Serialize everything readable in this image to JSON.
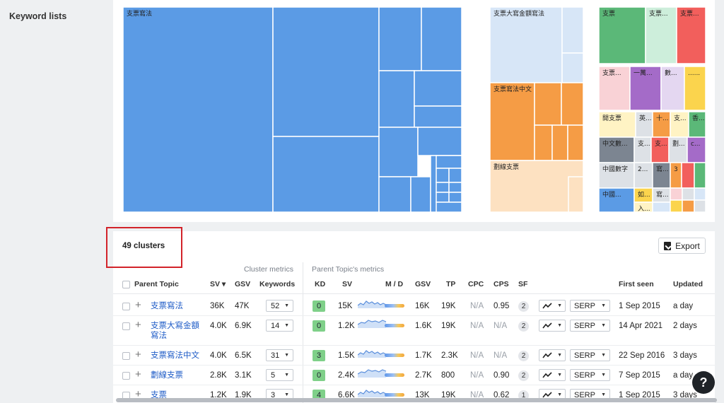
{
  "sidebar": {
    "title": "Keyword lists"
  },
  "treemap": {
    "labels": {
      "big": "支票寫法",
      "mid1": "支票大寫金額寫法",
      "mid2": "支票寫法中文",
      "mid3": "劃線支票",
      "s1": "支票",
      "s2": "支票...",
      "s3": "支票...",
      "r1": "支票...",
      "r2": "一萬...",
      "r3": "數...",
      "r4": "......",
      "r5": "開支票",
      "r6": "英...",
      "r7": "十...",
      "r8": "支...",
      "r9": "香...",
      "r10": "中文數...",
      "r11": "支...",
      "r12": "支...",
      "r13": "劃...",
      "r14": "c...",
      "r15": "中國數字",
      "r16": "2...",
      "r17": "寫...",
      "r18": "3",
      "r19": "中國...",
      "r20": "如...",
      "r21": "寫...",
      "r22": "入..."
    },
    "colors": {
      "blue": "#5b9be5",
      "lightblue": "#d7e6f7",
      "orange": "#f59c45",
      "peach": "#fde1c1",
      "green": "#5bb878",
      "mint": "#cdeedb",
      "red": "#f25f5c",
      "pink": "#f9d2d6",
      "purple": "#a46bc8",
      "lavender": "#e4d7f1",
      "yellow": "#fbd44d",
      "lightyellow": "#fff3c4",
      "gray": "#7c8591",
      "lightgray": "#dde1e6"
    }
  },
  "table": {
    "clusters_label": "49 clusters",
    "export_label": "Export",
    "group_cluster": "Cluster metrics",
    "group_parent": "Parent Topic's metrics",
    "headers": {
      "parent_topic": "Parent Topic",
      "sv": "SV ▾",
      "gsv": "GSV",
      "keywords": "Keywords",
      "kd": "KD",
      "ptsv": "SV",
      "md": "M / D",
      "ptgsv": "GSV",
      "tp": "TP",
      "cpc": "CPC",
      "cps": "CPS",
      "sf": "SF",
      "first_seen": "First seen",
      "updated": "Updated"
    },
    "rows": [
      {
        "topic": "支票寫法",
        "sv": "36K",
        "gsv": "47K",
        "keywords": "52",
        "kd": "0",
        "ptsv": "15K",
        "ptgsv": "16K",
        "tp": "19K",
        "cpc": "N/A",
        "cps": "0.95",
        "sf": "2",
        "serp": "SERP",
        "first_seen": "1 Sep 2015",
        "updated": "a day"
      },
      {
        "topic": "支票大寫金額寫法",
        "sv": "4.0K",
        "gsv": "6.9K",
        "keywords": "14",
        "kd": "0",
        "ptsv": "1.2K",
        "ptgsv": "1.6K",
        "tp": "19K",
        "cpc": "N/A",
        "cps": "N/A",
        "sf": "2",
        "serp": "SERP",
        "first_seen": "14 Apr 2021",
        "updated": "2 days"
      },
      {
        "topic": "支票寫法中文",
        "sv": "4.0K",
        "gsv": "6.5K",
        "keywords": "31",
        "kd": "3",
        "ptsv": "1.5K",
        "ptgsv": "1.7K",
        "tp": "2.3K",
        "cpc": "N/A",
        "cps": "N/A",
        "sf": "2",
        "serp": "SERP",
        "first_seen": "22 Sep 2016",
        "updated": "3 days"
      },
      {
        "topic": "劃線支票",
        "sv": "2.8K",
        "gsv": "3.1K",
        "keywords": "5",
        "kd": "0",
        "ptsv": "2.4K",
        "ptgsv": "2.7K",
        "tp": "800",
        "cpc": "N/A",
        "cps": "0.90",
        "sf": "2",
        "serp": "SERP",
        "first_seen": "7 Sep 2015",
        "updated": "a day"
      },
      {
        "topic": "支票",
        "sv": "1.2K",
        "gsv": "1.9K",
        "keywords": "3",
        "kd": "4",
        "ptsv": "6.6K",
        "ptgsv": "13K",
        "tp": "19K",
        "cpc": "N/A",
        "cps": "0.62",
        "sf": "1",
        "serp": "SERP",
        "first_seen": "1 Sep 2015",
        "updated": "3 days"
      }
    ]
  },
  "help_label": "?"
}
